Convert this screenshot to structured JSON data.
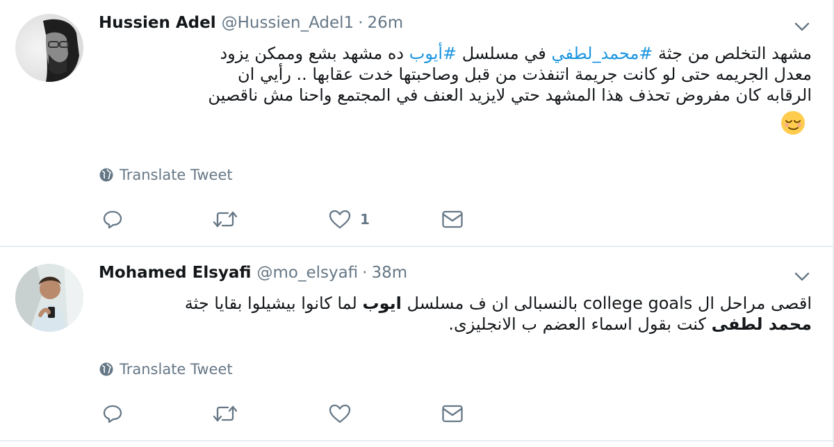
{
  "tweets": [
    {
      "name": "Hussien Adel",
      "handle": "@Hussien_Adel1",
      "separator": "·",
      "time": "26m",
      "text": {
        "line1": {
          "part1": "مشهد التخلص من جثة ",
          "hashtag1": "#محمد_لطفي",
          "part2": " في مسلسل ",
          "hashtag2": "#أيوب",
          "part3": " ده مشهد بشع وممكن يزود"
        },
        "line2": "معدل الجريمه حتى لو كانت جريمة اتنفذت من قبل وصاحبتها خدت عقابها .. رأيي ان",
        "line3": "الرقابه كان مفروض تحذف هذا المشهد حتي لايزيد العنف في المجتمع واحنا مش ناقصين",
        "emoji": "😌"
      },
      "translate_label": "Translate Tweet",
      "actions": {
        "reply": "",
        "retweet": "",
        "like": "1",
        "dm": ""
      }
    },
    {
      "name": "Mohamed Elsyafi",
      "handle": "@mo_elsyafi",
      "separator": "·",
      "time": "38m",
      "text": {
        "line1": {
          "part1": "اقصى مراحل ال college goals بالنسبالى ان ف مسلسل ",
          "bold1": "ايوب",
          "part2": " لما كانوا بيشيلوا بقايا جثة"
        },
        "line2": {
          "bold1": "محمد لطفى",
          "part1": " كنت بقول اسماء العضم ب الانجليزى."
        }
      },
      "translate_label": "Translate Tweet",
      "actions": {
        "reply": "",
        "retweet": "",
        "like": "",
        "dm": ""
      }
    }
  ],
  "colors": {
    "hashtag": "#1b95e0",
    "secondary": "#657786",
    "divider": "#e6ecf0",
    "text": "#14171a"
  },
  "icons": [
    "globe-icon",
    "reply-icon",
    "retweet-icon",
    "heart-icon",
    "envelope-icon",
    "chevron-down-icon"
  ]
}
